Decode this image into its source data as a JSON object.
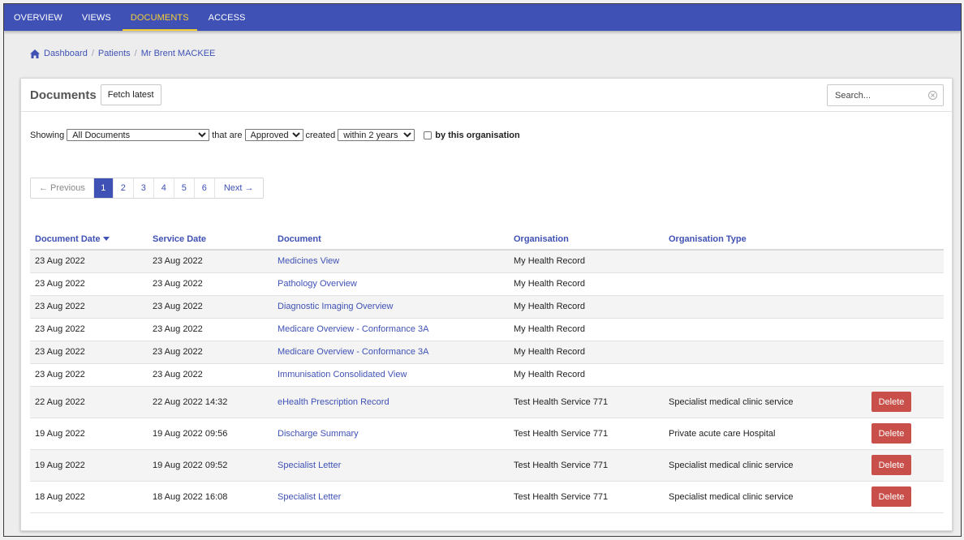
{
  "nav": {
    "items": [
      {
        "label": "OVERVIEW",
        "active": false
      },
      {
        "label": "VIEWS",
        "active": false
      },
      {
        "label": "DOCUMENTS",
        "active": true
      },
      {
        "label": "ACCESS",
        "active": false
      }
    ],
    "background": "#3f51b5",
    "active_color": "#f5d033"
  },
  "breadcrumb": {
    "icon": "home-icon",
    "items": [
      "Dashboard",
      "Patients",
      "Mr Brent MACKEE"
    ]
  },
  "documents": {
    "title": "Documents",
    "fetch_label": "Fetch latest",
    "search": {
      "placeholder": "Search...",
      "value": ""
    }
  },
  "filters": {
    "showing_label": "Showing",
    "document_type": "All Documents",
    "that_are_label": "that are",
    "status": "Approved",
    "created_label": "created",
    "created_range": "within 2 years",
    "org_checkbox_label": "by this organisation",
    "org_checkbox_checked": false
  },
  "pagination": {
    "previous": "← Previous",
    "pages": [
      "1",
      "2",
      "3",
      "4",
      "5",
      "6"
    ],
    "current": "1",
    "next": "Next →"
  },
  "table": {
    "columns": [
      "Document Date",
      "Service Date",
      "Document",
      "Organisation",
      "Organisation Type"
    ],
    "sort_column": "Document Date",
    "sort_direction": "descending",
    "delete_label": "Delete",
    "rows": [
      {
        "doc_date": "23 Aug 2022",
        "service_date": "23 Aug 2022",
        "document": "Medicines View",
        "organisation": "My Health Record",
        "org_type": "",
        "deletable": false
      },
      {
        "doc_date": "23 Aug 2022",
        "service_date": "23 Aug 2022",
        "document": "Pathology Overview",
        "organisation": "My Health Record",
        "org_type": "",
        "deletable": false
      },
      {
        "doc_date": "23 Aug 2022",
        "service_date": "23 Aug 2022",
        "document": "Diagnostic Imaging Overview",
        "organisation": "My Health Record",
        "org_type": "",
        "deletable": false
      },
      {
        "doc_date": "23 Aug 2022",
        "service_date": "23 Aug 2022",
        "document": "Medicare Overview - Conformance 3A",
        "organisation": "My Health Record",
        "org_type": "",
        "deletable": false
      },
      {
        "doc_date": "23 Aug 2022",
        "service_date": "23 Aug 2022",
        "document": "Medicare Overview - Conformance 3A",
        "organisation": "My Health Record",
        "org_type": "",
        "deletable": false
      },
      {
        "doc_date": "23 Aug 2022",
        "service_date": "23 Aug 2022",
        "document": "Immunisation Consolidated View",
        "organisation": "My Health Record",
        "org_type": "",
        "deletable": false
      },
      {
        "doc_date": "22 Aug 2022",
        "service_date": "22 Aug 2022 14:32",
        "document": "eHealth Prescription Record",
        "organisation": "Test Health Service 771",
        "org_type": "Specialist medical clinic service",
        "deletable": true
      },
      {
        "doc_date": "19 Aug 2022",
        "service_date": "19 Aug 2022 09:56",
        "document": "Discharge Summary",
        "organisation": "Test Health Service 771",
        "org_type": "Private acute care Hospital",
        "deletable": true
      },
      {
        "doc_date": "19 Aug 2022",
        "service_date": "19 Aug 2022 09:52",
        "document": "Specialist Letter",
        "organisation": "Test Health Service 771",
        "org_type": "Specialist medical clinic service",
        "deletable": true
      },
      {
        "doc_date": "18 Aug 2022",
        "service_date": "18 Aug 2022 16:08",
        "document": "Specialist Letter",
        "organisation": "Test Health Service 771",
        "org_type": "Specialist medical clinic service",
        "deletable": true
      }
    ]
  },
  "colors": {
    "link": "#3f51b5",
    "delete": "#c9504a"
  }
}
